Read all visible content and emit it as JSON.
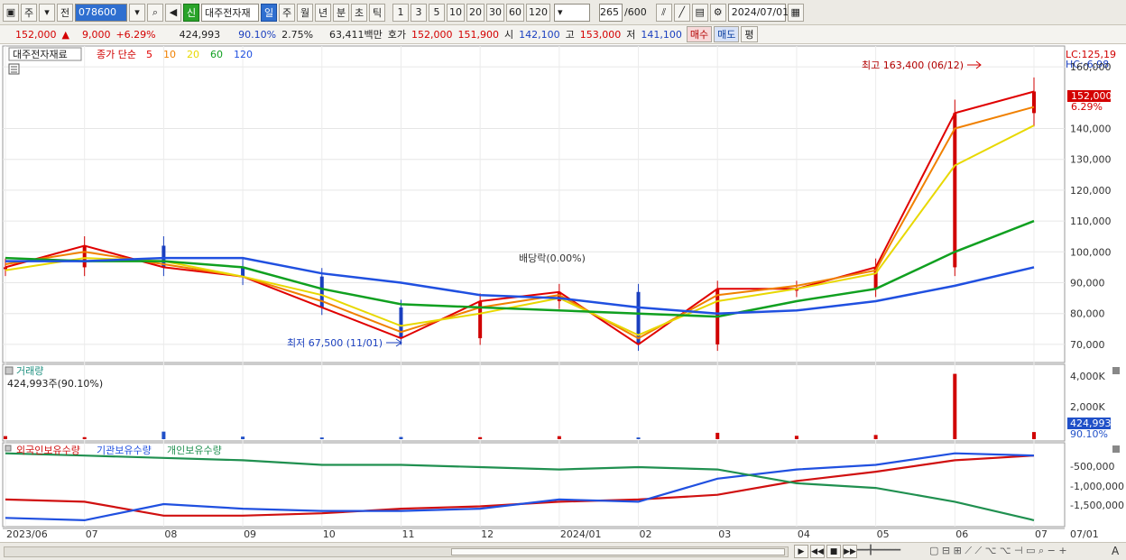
{
  "toolbar": {
    "market": "주",
    "prev_label": "전",
    "code": "078600",
    "tag": "신",
    "stock_name": "대주전자재",
    "periods": [
      "일",
      "주",
      "월",
      "년",
      "분",
      "초",
      "틱"
    ],
    "active_period": "일",
    "intervals": [
      "1",
      "3",
      "5",
      "10",
      "20",
      "30",
      "60",
      "120"
    ],
    "count": "265",
    "count_max": "/600",
    "date": "2024/07/01"
  },
  "info": {
    "price": "152,000",
    "change": "9,000",
    "change_pct": "+6.29%",
    "volume": "424,993",
    "vol_ratio": "90.10%",
    "turnover": "2.75%",
    "amount": "63,411백만",
    "quote_label": "호가",
    "ask": "152,000",
    "bid": "151,900",
    "open_label": "시",
    "open": "142,100",
    "high_label": "고",
    "high": "153,000",
    "low_label": "저",
    "low": "141,100",
    "buy_label": "매수",
    "sell_label": "매도",
    "eval_label": "평"
  },
  "price_panel": {
    "title": "대주전자재료",
    "ma_label": "종가 단순",
    "ma_periods": [
      {
        "label": "5",
        "color": "#e00000"
      },
      {
        "label": "10",
        "color": "#f08000"
      },
      {
        "label": "20",
        "color": "#e8d800"
      },
      {
        "label": "60",
        "color": "#10a020"
      },
      {
        "label": "120",
        "color": "#2050e0"
      }
    ],
    "lc": "LC:125,19",
    "hc": "HC:-6.98",
    "high_note": "최고 163,400 (06/12)",
    "low_note": "최저 67,500 (11/01)",
    "div_note": "배당락(0.00%)",
    "cur_price": "152,000",
    "cur_pct": "6.29%",
    "y_ticks": [
      "160,000",
      "140,000",
      "130,000",
      "120,000",
      "110,000",
      "100,000",
      "90,000",
      "80,000",
      "70,000"
    ]
  },
  "volume_panel": {
    "title": "거래량",
    "value_label": "424,993주(90.10%)",
    "y_ticks": [
      "4,000K",
      "2,000K"
    ],
    "cur": "424,993",
    "cur_pct": "90.10%"
  },
  "holding_panel": {
    "series": [
      {
        "name": "외국인보유수량",
        "color": "#d01010"
      },
      {
        "name": "기관보유수량",
        "color": "#2050e0"
      },
      {
        "name": "개인보유수량",
        "color": "#209050"
      }
    ],
    "y_ticks": [
      "-500,000",
      "-1,000,000",
      "-1,500,000"
    ]
  },
  "x_labels": [
    "2023/06",
    "07",
    "08",
    "09",
    "10",
    "11",
    "12",
    "2024/01",
    "02",
    "03",
    "04",
    "05",
    "06",
    "07",
    "07/01"
  ],
  "chart_data": {
    "type": "line",
    "title": "대주전자재료",
    "x": [
      "2023/06",
      "07",
      "08",
      "09",
      "10",
      "11",
      "12",
      "2024/01",
      "02",
      "03",
      "04",
      "05",
      "06",
      "07"
    ],
    "ylim": [
      65000,
      165000
    ],
    "series": [
      {
        "values": [
          95000,
          102000,
          95000,
          92000,
          82000,
          72000,
          84000,
          87000,
          70000,
          88000,
          88000,
          95000,
          145000,
          152000
        ]
      },
      {
        "values": [
          96000,
          100000,
          96000,
          92000,
          84000,
          74000,
          82000,
          86000,
          72000,
          86000,
          89000,
          94000,
          140000,
          147000
        ]
      },
      {
        "values": [
          94000,
          98000,
          97000,
          92000,
          86000,
          76000,
          80000,
          85000,
          73000,
          84000,
          88000,
          93000,
          128000,
          141000
        ]
      },
      {
        "values": [
          98000,
          97000,
          97000,
          95000,
          88000,
          83000,
          82000,
          81000,
          80000,
          79000,
          84000,
          88000,
          100000,
          110000
        ]
      },
      {
        "values": [
          97000,
          97000,
          98000,
          98000,
          93000,
          90000,
          86000,
          85000,
          82000,
          80000,
          81000,
          84000,
          89000,
          95000
        ]
      }
    ],
    "volume": [
      180,
      120,
      450,
      150,
      100,
      130,
      120,
      180,
      100,
      380,
      200,
      250,
      3900,
      425
    ],
    "holdings": [
      {
        "name": "외국인보유수량",
        "values": [
          -1300000,
          -1350000,
          -1650000,
          -1650000,
          -1600000,
          -1500000,
          -1450000,
          -1350000,
          -1300000,
          -1200000,
          -900000,
          -700000,
          -450000,
          -350000
        ]
      },
      {
        "name": "기관보유수량",
        "values": [
          -1700000,
          -1750000,
          -1400000,
          -1500000,
          -1550000,
          -1550000,
          -1500000,
          -1300000,
          -1350000,
          -850000,
          -650000,
          -550000,
          -300000,
          -350000
        ]
      },
      {
        "name": "개인보유수량",
        "values": [
          -300000,
          -350000,
          -400000,
          -450000,
          -550000,
          -550000,
          -600000,
          -650000,
          -600000,
          -650000,
          -950000,
          -1050000,
          -1350000,
          -1750000
        ]
      }
    ]
  }
}
